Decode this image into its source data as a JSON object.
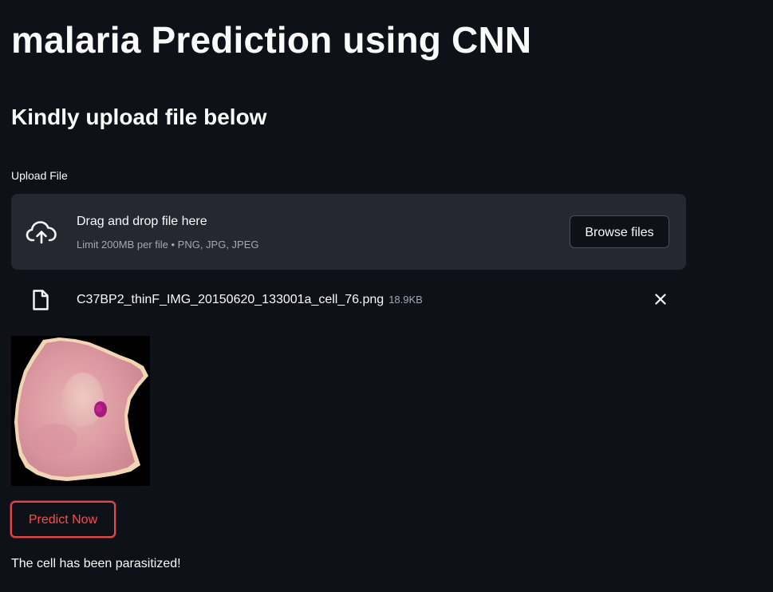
{
  "header": {
    "title": "malaria Prediction using CNN",
    "subtitle": "Kindly upload file below"
  },
  "uploader": {
    "label": "Upload File",
    "drop_text": "Drag and drop file here",
    "limit_text": "Limit 200MB per file • PNG, JPG, JPEG",
    "browse_label": "Browse files",
    "icon": "cloud-upload-icon"
  },
  "uploaded_file": {
    "name": "C37BP2_thinF_IMG_20150620_133001a_cell_76.png",
    "size": "18.9KB",
    "icon": "file-icon",
    "remove_icon": "close-icon"
  },
  "preview": {
    "alt": "uploaded cell image"
  },
  "predict": {
    "label": "Predict Now"
  },
  "result": {
    "text": "The cell has been parasitized!"
  },
  "colors": {
    "background": "#0e1117",
    "panel": "#262730",
    "accent": "#ff4b4b",
    "text": "#fafafa",
    "muted": "#a3a8b4"
  }
}
